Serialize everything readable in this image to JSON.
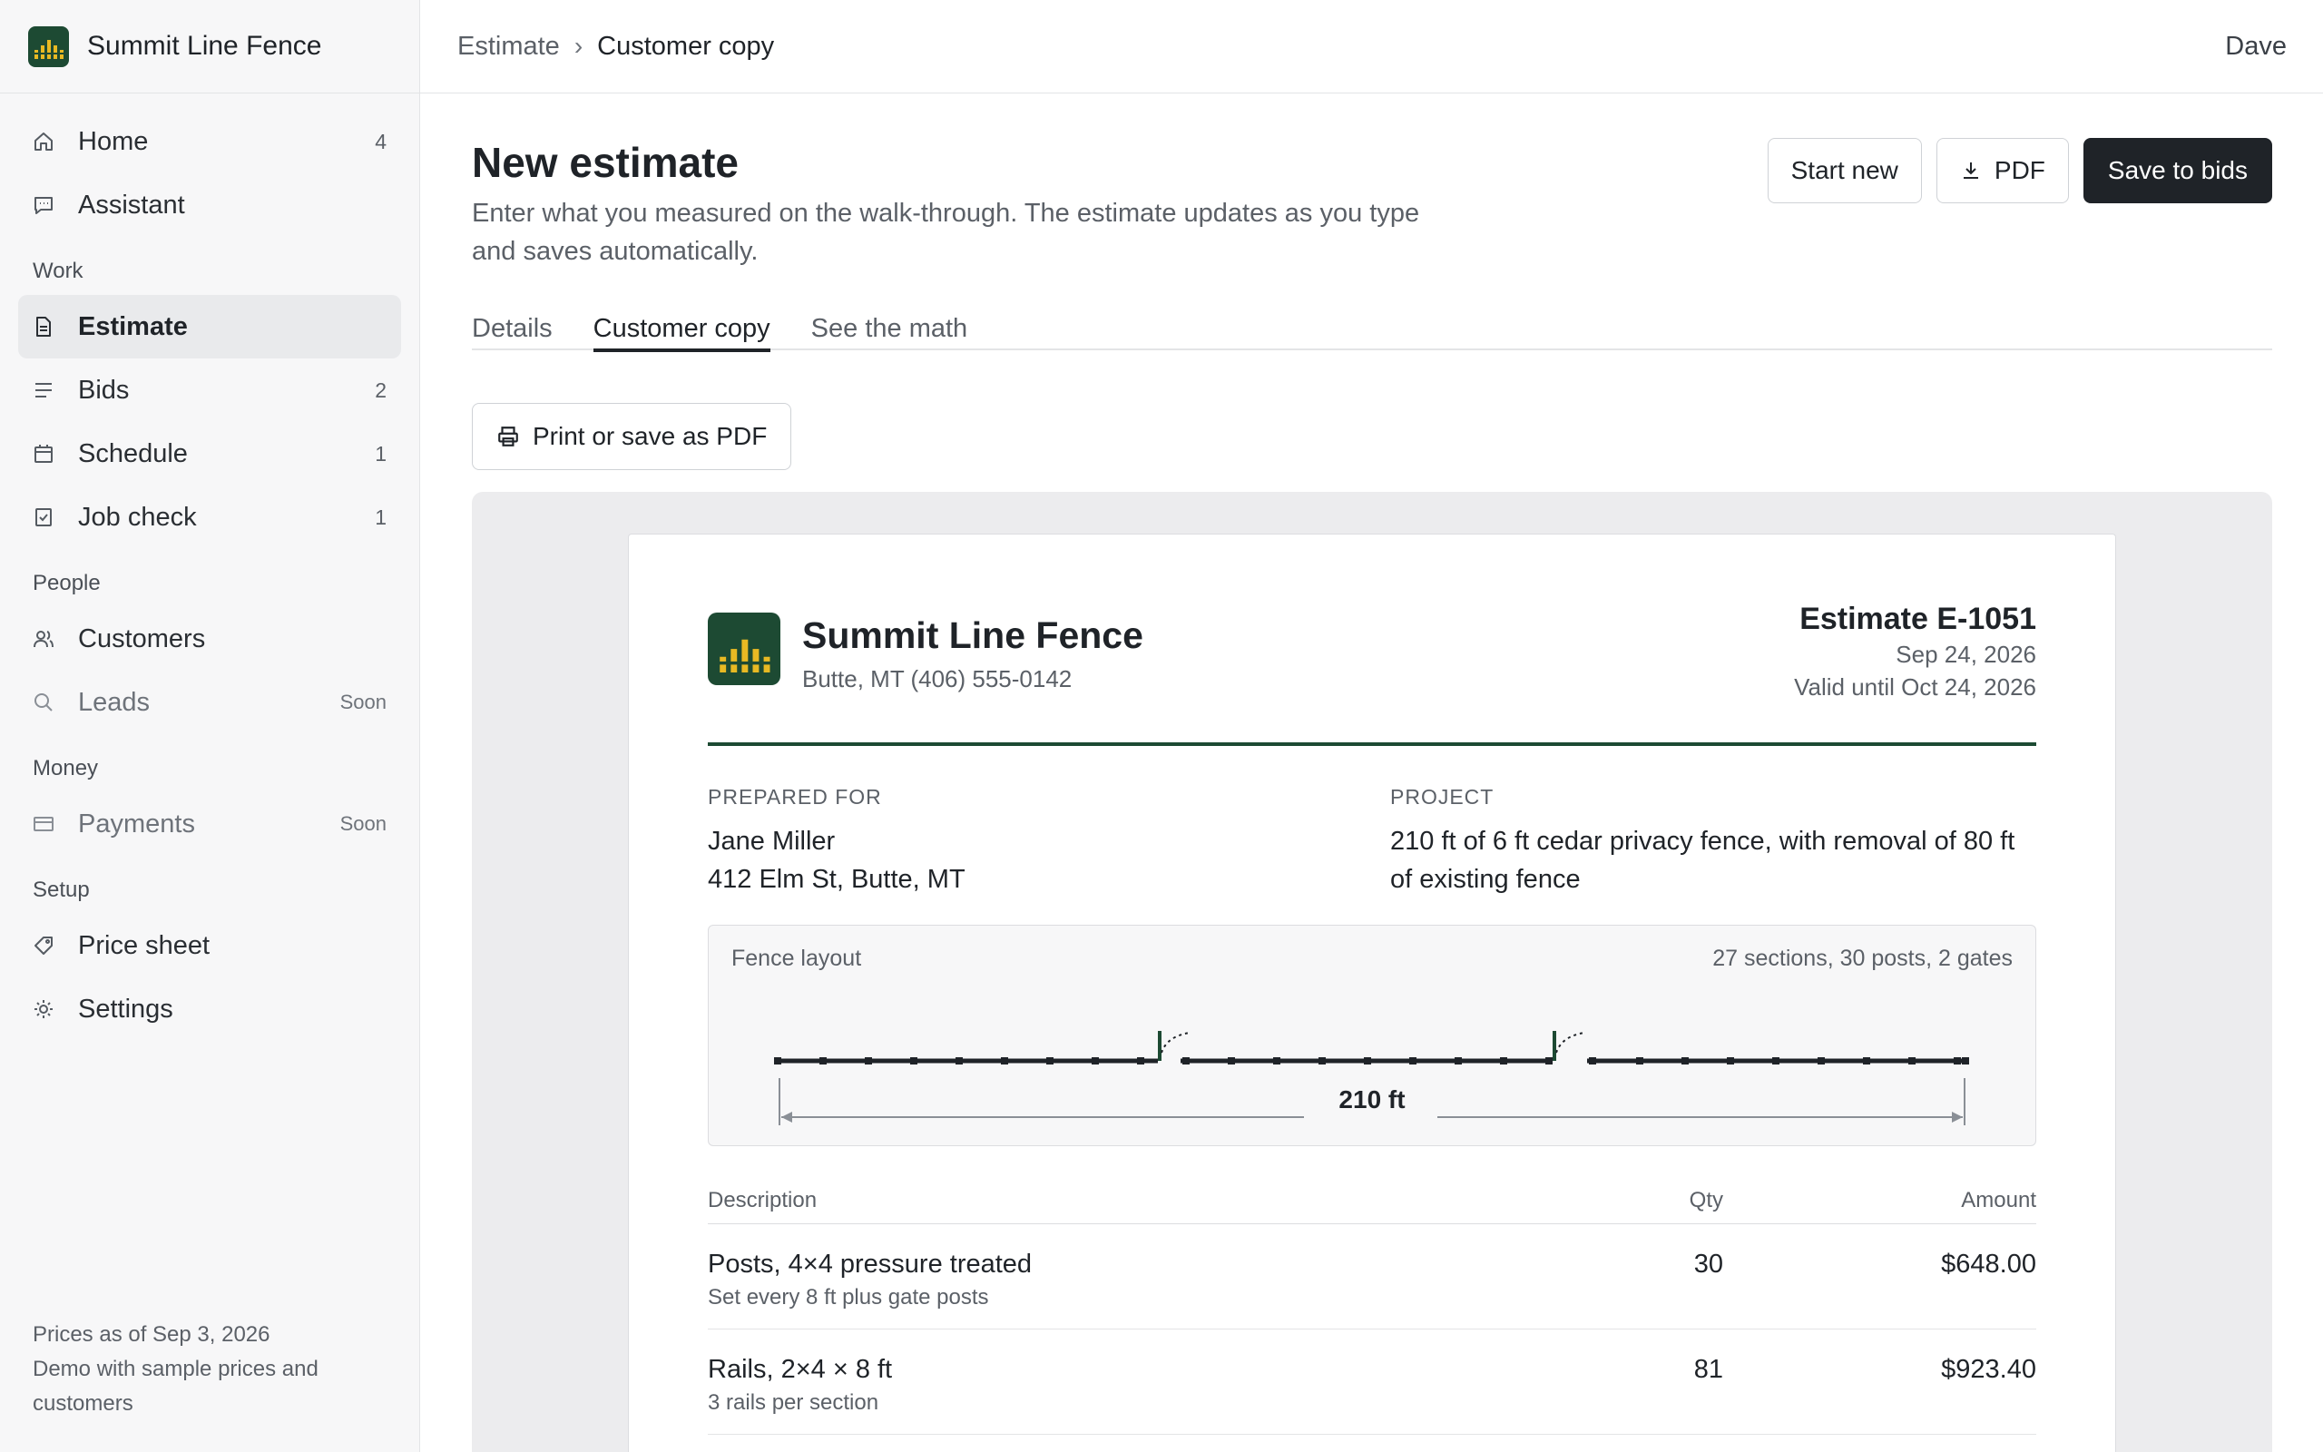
{
  "app": {
    "name": "Summit Line Fence",
    "user": "Dave"
  },
  "breadcrumb": {
    "parent": "Estimate",
    "separator": "›",
    "current": "Customer copy"
  },
  "sidebar": {
    "home": {
      "label": "Home",
      "count": "4",
      "icon": "home-icon"
    },
    "assistant": {
      "label": "Assistant",
      "icon": "chat-icon"
    },
    "work_title": "Work",
    "estimate": {
      "label": "Estimate",
      "icon": "document-icon"
    },
    "bids": {
      "label": "Bids",
      "count": "2",
      "icon": "list-icon"
    },
    "schedule": {
      "label": "Schedule",
      "count": "1",
      "icon": "calendar-icon"
    },
    "job_check": {
      "label": "Job check",
      "count": "1",
      "icon": "checkbox-icon"
    },
    "people_title": "People",
    "customers": {
      "label": "Customers",
      "icon": "users-icon"
    },
    "leads": {
      "label": "Leads",
      "badge": "Soon",
      "icon": "search-icon"
    },
    "money_title": "Money",
    "payments": {
      "label": "Payments",
      "badge": "Soon",
      "icon": "card-icon"
    },
    "setup_title": "Setup",
    "price_sheet": {
      "label": "Price sheet",
      "icon": "tag-icon"
    },
    "settings": {
      "label": "Settings",
      "icon": "gear-icon"
    },
    "footer_line1": "Prices as of Sep 3, 2026",
    "footer_line2": "Demo with sample prices and customers"
  },
  "page": {
    "title": "New estimate",
    "subtitle": "Enter what you measured on the walk-through. The estimate updates as you type and saves automatically.",
    "actions": {
      "start_new": "Start new",
      "pdf": "PDF",
      "save": "Save to bids"
    },
    "tabs": {
      "details": "Details",
      "customer_copy": "Customer copy",
      "math": "See the math"
    },
    "print_button": "Print or save as PDF"
  },
  "document": {
    "company": "Summit Line Fence",
    "contact": "Butte, MT (406) 555-0142",
    "estimate_number": "Estimate E-1051",
    "date": "Sep 24, 2026",
    "valid_until": "Valid until Oct 24, 2026",
    "prepared_for_label": "PREPARED FOR",
    "customer_name": "Jane Miller",
    "customer_address": "412 Elm St, Butte, MT",
    "project_label": "PROJECT",
    "project_text": "210 ft of 6 ft cedar privacy fence, with removal of 80 ft of existing fence",
    "layout": {
      "title": "Fence layout",
      "summary": "27 sections, 30 posts, 2 gates",
      "total_length": "210 ft"
    },
    "table": {
      "headers": {
        "description": "Description",
        "qty": "Qty",
        "amount": "Amount"
      },
      "rows": [
        {
          "title": "Posts, 4×4 pressure treated",
          "note": "Set every 8 ft plus gate posts",
          "qty": "30",
          "amount": "$648.00"
        },
        {
          "title": "Rails, 2×4 × 8 ft",
          "note": "3 rails per section",
          "qty": "81",
          "amount": "$923.40"
        }
      ]
    }
  },
  "colors": {
    "brand": "#1d4a33",
    "accent": "#e8b923",
    "primary_button": "#1f2328"
  }
}
